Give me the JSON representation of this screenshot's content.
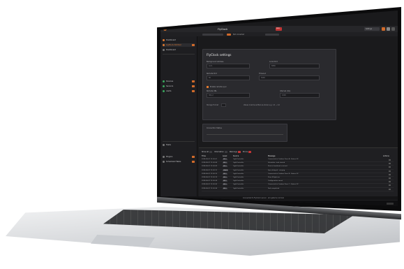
{
  "app": {
    "title": "FlyClock",
    "titlebar_badge": "NEW",
    "brand_color": "#e0792f",
    "danger_color": "#c23535"
  },
  "toolbar": {
    "center_label": "Not connected",
    "right_label": "Settings"
  },
  "sidebar": {
    "items": [
      {
        "label": "Dashboard",
        "icon": "grid-icon"
      },
      {
        "label": "Lights & Outdoor"
      },
      {
        "label": "Dashboard"
      },
      {
        "label": "Devices"
      },
      {
        "label": "Sensors"
      },
      {
        "label": "Alerts"
      },
      {
        "label": "Tools"
      },
      {
        "label": "Servers"
      },
      {
        "label": "Scheduler"
      }
    ],
    "lower_items": [
      {
        "label": "Tasks"
      },
      {
        "label": "Plugins"
      },
      {
        "label": "Scheduled Tasks"
      }
    ]
  },
  "settings_card": {
    "title": "FlyClock settings",
    "fields": [
      {
        "label": "Background Address",
        "value": "Auto"
      },
      {
        "label": "Local Port",
        "value": "8080"
      },
      {
        "label": "Remote Port",
        "value": "80"
      },
      {
        "label": "Timeout",
        "value": "5000"
      },
      {
        "label": "Remote URL",
        "value": "http://"
      },
      {
        "label": "Interval (ms)",
        "value": "1000"
      }
    ],
    "checkbox_label": "Enable remote sync",
    "hint_label": "Storage Format",
    "hint_text": "Values must be written as shown e.g. 1.0 → 1.0"
  },
  "small_card": {
    "label": "Connection Status"
  },
  "logs": {
    "filters": [
      {
        "label": "Show all",
        "badge_color": "#3a3a3e"
      },
      {
        "label": "Information",
        "badge_color": "#3a3a3e"
      },
      {
        "label": "Warnings",
        "badge_color": "#c23535"
      },
      {
        "label": "Errors",
        "badge_color": "#c23535"
      }
    ],
    "columns": [
      "Time",
      "Level",
      "Source",
      "Message",
      "Actions"
    ],
    "rows": [
      {
        "time": "2024-06-01 12:00:01",
        "level": "INFO",
        "source": "LightController",
        "message": "Connected to Outdoor Zone A - Status OK"
      },
      {
        "time": "2024-06-01 12:00:04",
        "level": "INFO",
        "source": "LightController",
        "message": "Scheduler: task started"
      },
      {
        "time": "2024-06-01 12:00:09",
        "level": "INFO",
        "source": "LightController",
        "message": "Device heartbeat received"
      },
      {
        "time": "2024-06-01 12:00:12",
        "level": "WARN",
        "source": "LightController",
        "message": "Sync delayed - retrying"
      },
      {
        "time": "2024-06-01 12:00:15",
        "level": "INFO",
        "source": "LightController",
        "message": "Connected to Outdoor Zone B - Status OK"
      },
      {
        "time": "2024-06-01 12:00:19",
        "level": "INFO",
        "source": "LightController",
        "message": "Zone B lights on"
      },
      {
        "time": "2024-06-01 12:00:24",
        "level": "INFO",
        "source": "LightController",
        "message": "Configuration saved"
      },
      {
        "time": "2024-06-01 12:00:30",
        "level": "INFO",
        "source": "LightController",
        "message": "Connected to Outdoor Zone C - Status OK"
      },
      {
        "time": "2024-06-01 12:00:36",
        "level": "INFO",
        "source": "LightController",
        "message": "Task completed"
      }
    ]
  },
  "statusbar": {
    "text": "Connected to FlyClock server - all systems nominal"
  }
}
